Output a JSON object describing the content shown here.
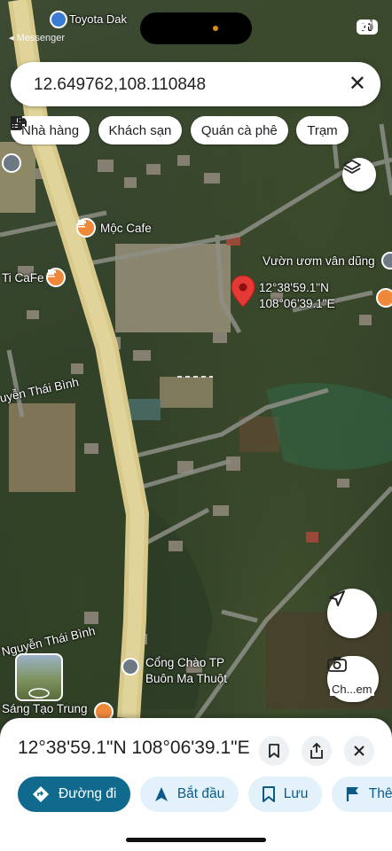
{
  "status_bar": {
    "battery": "90",
    "back_label": "◂ Messenger",
    "top_label": "Toyota Dak"
  },
  "search": {
    "value": "12.649762,108.110848",
    "clear_label": "✕"
  },
  "chips": [
    {
      "label": "Nhà hàng",
      "icon": "fork-knife-icon"
    },
    {
      "label": "Khách sạn",
      "icon": "bed-icon"
    },
    {
      "label": "Quán cà phê",
      "icon": "coffee-cup-icon"
    },
    {
      "label": "Trạm",
      "icon": "fuel-pump-icon"
    }
  ],
  "map": {
    "labels": {
      "moc_cafe": "Mộc Cafe",
      "ti_cafe": "Ti CaFe",
      "vuon_uom": "Vườn ươm vân dũng",
      "nguyen_thai_binh_1": "uyễn Thái Bình",
      "nguyen_thai_binh_2": "Nguyễn Thái Bình",
      "cong_chao_1": "Cổng Chào TP",
      "cong_chao_2": "Buôn Ma Thuột",
      "sang_tao": "Sáng Tạo Trung",
      "pin_lat": "12°38'59.1\"N",
      "pin_lng": "108°06'39.1\"E",
      "street_view": "Ch...em"
    },
    "colors": {
      "road_main": "#d8c98a",
      "pin": "#e53935",
      "poi": "#f0883a"
    }
  },
  "sheet": {
    "title": "12°38'59.1\"N 108°06'39.1\"E",
    "actions": [
      {
        "label": "Đường đi",
        "icon": "directions-icon",
        "primary": true
      },
      {
        "label": "Bắt đầu",
        "icon": "navigation-arrow-icon",
        "primary": false
      },
      {
        "label": "Lưu",
        "icon": "bookmark-icon",
        "primary": false
      },
      {
        "label": "Thêm",
        "icon": "flag-icon",
        "primary": false
      }
    ]
  }
}
